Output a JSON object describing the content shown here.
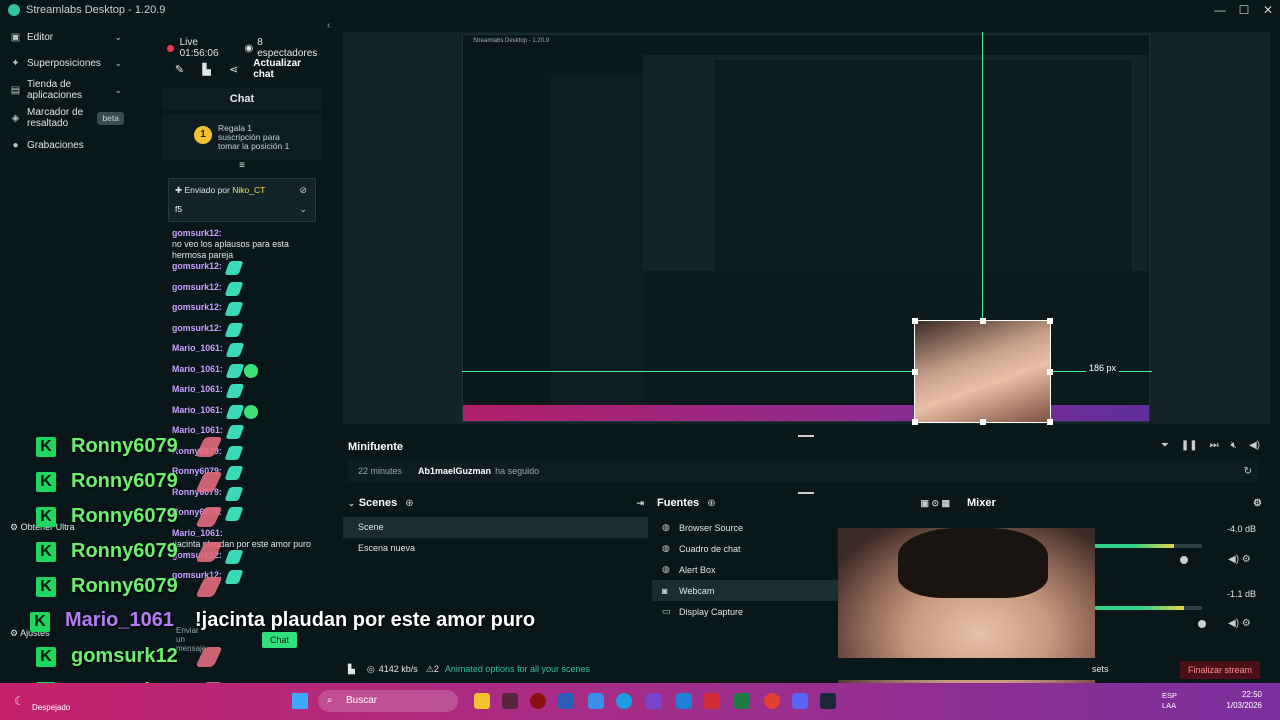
{
  "window": {
    "title": "Streamlabs Desktop - 1.20.9",
    "minimize": "—",
    "maximize": "☐",
    "close": "✕"
  },
  "nav": {
    "items": [
      {
        "label": "Editor",
        "icon": "editor-icon",
        "glyph": "▣",
        "chevron": "⌄"
      },
      {
        "label": "Superposiciones",
        "icon": "themes-icon",
        "glyph": "✦",
        "chevron": "⌄"
      },
      {
        "label": "Tienda de aplicaciones",
        "icon": "store-icon",
        "glyph": "▤",
        "chevron": "⌄"
      },
      {
        "label": "Marcador de resaltado",
        "icon": "highlighter-icon",
        "glyph": "◈",
        "badge": "beta"
      },
      {
        "label": "Grabaciones",
        "icon": "recordings-icon",
        "glyph": "●"
      }
    ],
    "collapse": "‹"
  },
  "live": {
    "status": "Live 01:56:06",
    "viewers": "8 espectadores",
    "refresh_chat": "Actualizar chat"
  },
  "chat": {
    "header": "Chat",
    "gift": {
      "rank": "1",
      "text1": "Regala 1",
      "text2": "suscripción para",
      "text3": "tomar la posición 1"
    },
    "filter_icon": "≡",
    "pinned": {
      "sent_by": "Enviado por",
      "sender": "Niko_CT",
      "message": "f5"
    },
    "messages": [
      {
        "user": "gomsurk12:",
        "text": "no veo los aplausos para esta hermosa pareja"
      },
      {
        "user": "gomsurk12:",
        "emotes": 1
      },
      {
        "user": "gomsurk12:",
        "emotes": 1
      },
      {
        "user": "gomsurk12:",
        "emotes": 1
      },
      {
        "user": "gomsurk12:",
        "emotes": 1
      },
      {
        "user": "Mario_1061:",
        "emotes": 1
      },
      {
        "user": "Mario_1061:",
        "emotes": 2
      },
      {
        "user": "Mario_1061:",
        "emotes": 1
      },
      {
        "user": "Mario_1061:",
        "emotes": 2
      },
      {
        "user": "Mario_1061:",
        "emotes": 1
      },
      {
        "user": "Ronny6079:",
        "emotes": 1
      },
      {
        "user": "Ronny6079:",
        "emotes": 1
      },
      {
        "user": "Ronny6079:",
        "emotes": 1
      },
      {
        "user": "Ronny6079:",
        "emotes": 1
      },
      {
        "user": "Mario_1061:",
        "text": "¡jacinta plaudan por este amor puro"
      },
      {
        "user": "gomsurk12:",
        "emotes": 1
      },
      {
        "user": "gomsurk12:",
        "emotes": 1
      }
    ],
    "input_placeholder": "Enviar un mensaje",
    "send_label": "Chat"
  },
  "overlay": {
    "names": [
      "Ronny6079",
      "Ronny6079",
      "Ronny6079",
      "Ronny6079",
      "Ronny6079"
    ],
    "mario": "Mario_1061",
    "mario_msg": "!jacinta plaudan por este amor puro",
    "gom1": "gomsurk12",
    "gom2": "gomsurk12",
    "k": "K"
  },
  "left_bottom": {
    "ultra": "Obtener Ultra",
    "settings": "Ajustes",
    "weather": "Despejado"
  },
  "preview": {
    "px_label": "186 px"
  },
  "minifuente": {
    "title": "Minifuente",
    "time": "22 minutes",
    "user": "Ab1maelGuzman",
    "action": "ha seguido"
  },
  "scenes": {
    "title": "Scenes",
    "items": [
      "Scene",
      "Escena nueva"
    ]
  },
  "sources": {
    "title": "Fuentes",
    "items": [
      "Browser Source",
      "Cuadro de chat",
      "Alert Box",
      "Webcam",
      "Display Capture"
    ]
  },
  "mixer": {
    "title": "Mixer",
    "db1": "-4.0 dB",
    "db2": "-1.1 dB",
    "level1": 0.88,
    "level2": 0.92
  },
  "status": {
    "bitrate": "4142 kb/s",
    "notifications": "2",
    "promo": "Animated options for all your scenes",
    "sets": "sets",
    "end_stream": "Finalizar stream"
  },
  "taskbar": {
    "search": "Buscar",
    "lang1": "ESP",
    "lang2": "LAA",
    "time": "22:50",
    "date": "1/03/2026"
  }
}
